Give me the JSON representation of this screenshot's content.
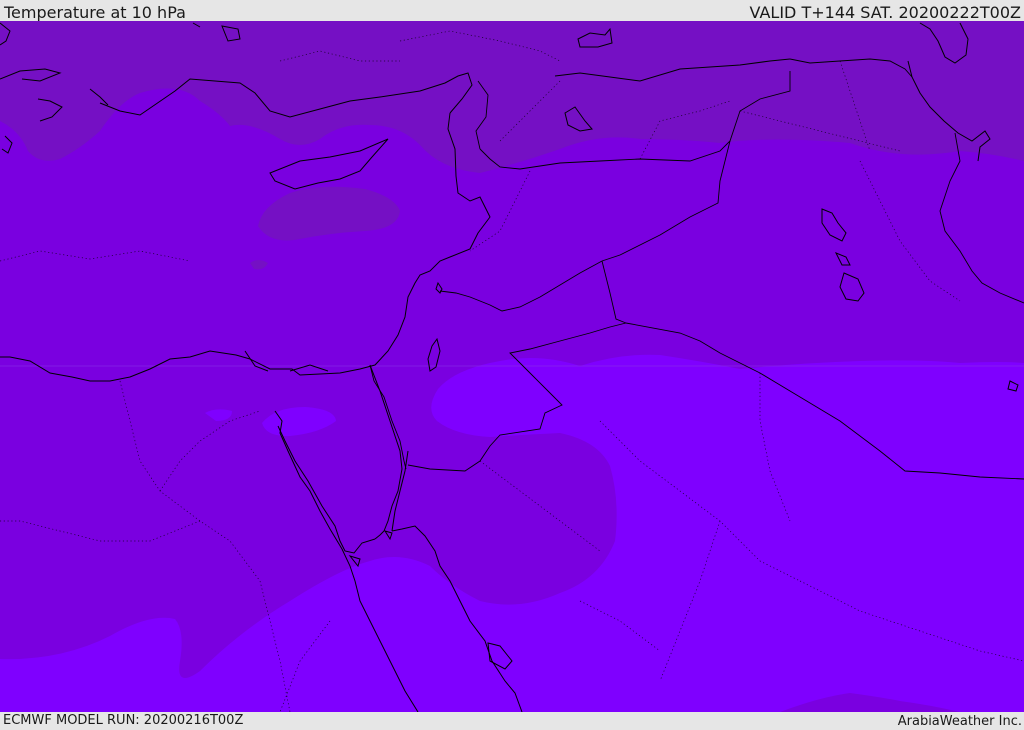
{
  "header": {
    "title": "Temperature at 10 hPa",
    "valid": "VALID T+144 SAT. 20200222T00Z"
  },
  "footer": {
    "model_run": "ECMWF MODEL RUN: 20200216T00Z",
    "credit": "ArabiaWeather Inc."
  },
  "map": {
    "region": "Eastern Mediterranean / Middle East",
    "colors": {
      "band_dark": "#7510c4",
      "band_mid": "#7a00e0",
      "band_light": "#7f00ff",
      "coastline": "#000000",
      "header_background": "#e6e6e6"
    }
  }
}
